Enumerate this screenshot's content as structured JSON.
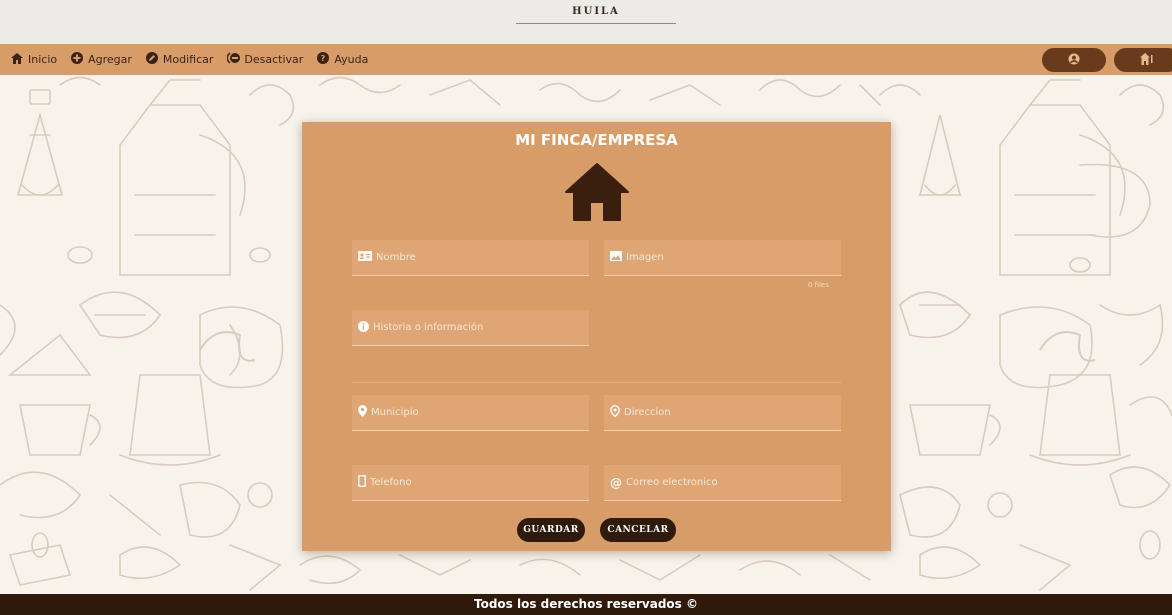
{
  "brand": {
    "title": "HUILA"
  },
  "nav": {
    "items": [
      {
        "label": "Inicio",
        "icon": "home-icon"
      },
      {
        "label": "Agregar",
        "icon": "plus-circle-icon"
      },
      {
        "label": "Modificar",
        "icon": "pencil-circle-icon"
      },
      {
        "label": "Desactivar",
        "icon": "minus-circle-icon"
      },
      {
        "label": "Ayuda",
        "icon": "question-circle-icon"
      }
    ],
    "right_buttons": [
      {
        "icon": "user-icon"
      },
      {
        "icon": "logout-home-icon"
      }
    ]
  },
  "form": {
    "title": "MI FINCA/EMPRESA",
    "icon": "house-icon",
    "fields": {
      "nombre": {
        "placeholder": "Nombre",
        "icon": "id-card-icon"
      },
      "imagen": {
        "placeholder": "Imagen",
        "icon": "image-icon",
        "note": "0 files"
      },
      "historia": {
        "placeholder": "Historia o información",
        "icon": "info-icon"
      },
      "municipio": {
        "placeholder": "Municipio",
        "icon": "map-marker-icon"
      },
      "direccion": {
        "placeholder": "Direccion",
        "icon": "location-icon"
      },
      "telefono": {
        "placeholder": "Telefono",
        "icon": "mobile-icon"
      },
      "correo": {
        "placeholder": "Correo electronico",
        "icon": "at-icon"
      }
    },
    "buttons": {
      "save": "GUARDAR",
      "cancel": "CANCELAR"
    }
  },
  "footer": {
    "text": "Todos los derechos reservados ©"
  },
  "colors": {
    "nav_bg": "#d89c68",
    "card_bg": "#d89c68",
    "dark_brown": "#2f1a0c",
    "button_brown": "#6a3a1c"
  }
}
